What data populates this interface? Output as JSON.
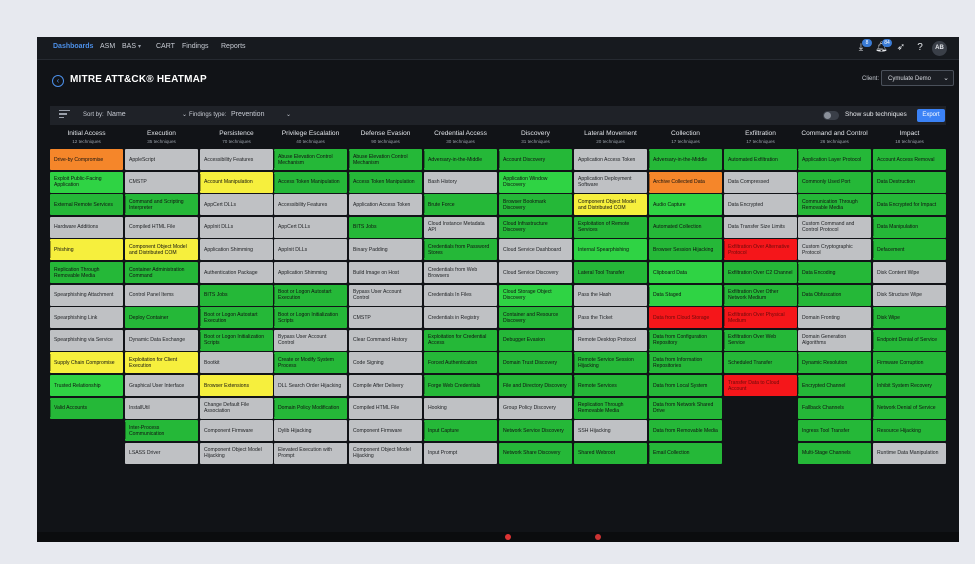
{
  "nav": {
    "items": [
      "Dashboards",
      "ASM",
      "BAS",
      "CART",
      "Findings",
      "Reports"
    ],
    "notif_badge_1": "8",
    "notif_badge_2": "84",
    "avatar": "AB"
  },
  "page": {
    "title": "MITRE ATT&CK® HEATMAP",
    "client_label": "Client:",
    "client_value": "Cymulate Demo"
  },
  "controls": {
    "sort_label": "Sort by:",
    "sort_value": "Name",
    "findings_label": "Findings type:",
    "findings_value": "Prevention",
    "toggle_label": "Show sub techniques",
    "export_label": "Export"
  },
  "colors": {
    "gray": "#bfc1c4",
    "green_bright": "#2fd344",
    "green": "#25b838",
    "green_dark": "#1aa32c",
    "lime": "#c8ef2c",
    "yellow": "#f6ef3d",
    "orange": "#f5862a",
    "red": "#f5161a",
    "accent": "#3b82f6"
  },
  "columns": [
    {
      "name": "Initial Access",
      "count": "12 techniques",
      "cells": [
        {
          "label": "Drive-by Compromise",
          "c": "orange"
        },
        {
          "label": "Exploit Public-Facing Application",
          "c": "g1"
        },
        {
          "label": "External Remote Services",
          "c": "g2"
        },
        {
          "label": "Hardware Additions",
          "c": "gray"
        },
        {
          "label": "Phishing",
          "c": "yellow",
          "s": 1
        },
        {
          "label": "Replication Through Removable Media",
          "c": "g2"
        },
        {
          "label": "Spearphishing Attachment",
          "c": "gray"
        },
        {
          "label": "Spearphishing Link",
          "c": "gray"
        },
        {
          "label": "Spearphishing via Service",
          "c": "gray"
        },
        {
          "label": "Supply Chain Compromise",
          "c": "yellow",
          "s": 1
        },
        {
          "label": "Trusted Relationship",
          "c": "g1"
        },
        {
          "label": "Valid Accounts",
          "c": "g2",
          "s": 1
        }
      ]
    },
    {
      "name": "Execution",
      "count": "35 techniques",
      "cells": [
        {
          "label": "AppleScript",
          "c": "gray"
        },
        {
          "label": "CMSTP",
          "c": "gray"
        },
        {
          "label": "Command and Scripting Interpreter",
          "c": "g2",
          "s": 1
        },
        {
          "label": "Compiled HTML File",
          "c": "gray"
        },
        {
          "label": "Component Object Model and Distributed COM",
          "c": "yellow"
        },
        {
          "label": "Container Administration Command",
          "c": "g2"
        },
        {
          "label": "Control Panel Items",
          "c": "gray"
        },
        {
          "label": "Deploy Container",
          "c": "g2"
        },
        {
          "label": "Dynamic Data Exchange",
          "c": "gray"
        },
        {
          "label": "Exploitation for Client Execution",
          "c": "yellow"
        },
        {
          "label": "Graphical User Interface",
          "c": "gray"
        },
        {
          "label": "InstallUtil",
          "c": "gray"
        },
        {
          "label": "Inter-Process Communication",
          "c": "g2",
          "s": 1
        },
        {
          "label": "LSASS Driver",
          "c": "gray"
        }
      ]
    },
    {
      "name": "Persistence",
      "count": "70 techniques",
      "cells": [
        {
          "label": "Accessibility Features",
          "c": "gray"
        },
        {
          "label": "Account Manipulation",
          "c": "yellow",
          "s": 1
        },
        {
          "label": "AppCert DLLs",
          "c": "gray"
        },
        {
          "label": "AppInit DLLs",
          "c": "gray"
        },
        {
          "label": "Application Shimming",
          "c": "gray"
        },
        {
          "label": "Authentication Package",
          "c": "gray"
        },
        {
          "label": "BITS Jobs",
          "c": "g2"
        },
        {
          "label": "Boot or Logon Autostart Execution",
          "c": "g2",
          "s": 1
        },
        {
          "label": "Boot or Logon Initialization Scripts",
          "c": "g2",
          "s": 1
        },
        {
          "label": "Bootkit",
          "c": "gray"
        },
        {
          "label": "Browser Extensions",
          "c": "yellow"
        },
        {
          "label": "Change Default File Association",
          "c": "gray"
        },
        {
          "label": "Component Firmware",
          "c": "gray"
        },
        {
          "label": "Component Object Model Hijacking",
          "c": "gray"
        }
      ]
    },
    {
      "name": "Privilege Escalation",
      "count": "40 techniques",
      "cells": [
        {
          "label": "Abuse Elevation Control Mechanism",
          "c": "g2",
          "s": 1
        },
        {
          "label": "Access Token Manipulation",
          "c": "g2",
          "s": 1
        },
        {
          "label": "Accessibility Features",
          "c": "gray"
        },
        {
          "label": "AppCert DLLs",
          "c": "gray"
        },
        {
          "label": "AppInit DLLs",
          "c": "gray"
        },
        {
          "label": "Application Shimming",
          "c": "gray"
        },
        {
          "label": "Boot or Logon Autostart Execution",
          "c": "g2",
          "s": 1
        },
        {
          "label": "Boot or Logon Initialization Scripts",
          "c": "g2",
          "s": 1
        },
        {
          "label": "Bypass User Account Control",
          "c": "gray"
        },
        {
          "label": "Create or Modify System Process",
          "c": "g2",
          "s": 1
        },
        {
          "label": "DLL Search Order Hijacking",
          "c": "gray"
        },
        {
          "label": "Domain Policy Modification",
          "c": "g2",
          "s": 1
        },
        {
          "label": "Dylib Hijacking",
          "c": "gray"
        },
        {
          "label": "Elevated Execution with Prompt",
          "c": "gray"
        }
      ]
    },
    {
      "name": "Defense Evasion",
      "count": "90 techniques",
      "cells": [
        {
          "label": "Abuse Elevation Control Mechanism",
          "c": "g2",
          "s": 1
        },
        {
          "label": "Access Token Manipulation",
          "c": "g2",
          "s": 1
        },
        {
          "label": "Application Access Token",
          "c": "gray"
        },
        {
          "label": "BITS Jobs",
          "c": "g2"
        },
        {
          "label": "Binary Padding",
          "c": "gray"
        },
        {
          "label": "Build Image on Host",
          "c": "gray"
        },
        {
          "label": "Bypass User Account Control",
          "c": "gray"
        },
        {
          "label": "CMSTP",
          "c": "gray"
        },
        {
          "label": "Clear Command History",
          "c": "gray"
        },
        {
          "label": "Code Signing",
          "c": "gray"
        },
        {
          "label": "Compile After Delivery",
          "c": "gray"
        },
        {
          "label": "Compiled HTML File",
          "c": "gray"
        },
        {
          "label": "Component Firmware",
          "c": "gray"
        },
        {
          "label": "Component Object Model Hijacking",
          "c": "gray"
        }
      ]
    },
    {
      "name": "Credential Access",
      "count": "30 techniques",
      "cells": [
        {
          "label": "Adversary-in-the-Middle",
          "c": "g2",
          "s": 1
        },
        {
          "label": "Bash History",
          "c": "gray"
        },
        {
          "label": "Brute Force",
          "c": "g2",
          "s": 1
        },
        {
          "label": "Cloud Instance Metadata API",
          "c": "gray"
        },
        {
          "label": "Credentials from Password Stores",
          "c": "g2",
          "s": 1
        },
        {
          "label": "Credentials from Web Browsers",
          "c": "gray"
        },
        {
          "label": "Credentials In Files",
          "c": "gray"
        },
        {
          "label": "Credentials in Registry",
          "c": "gray"
        },
        {
          "label": "Exploitation for Credential Access",
          "c": "g2"
        },
        {
          "label": "Forced Authentication",
          "c": "g2"
        },
        {
          "label": "Forge Web Credentials",
          "c": "g2",
          "s": 1
        },
        {
          "label": "Hooking",
          "c": "gray"
        },
        {
          "label": "Input Capture",
          "c": "g2",
          "s": 1
        },
        {
          "label": "Input Prompt",
          "c": "gray"
        }
      ]
    },
    {
      "name": "Discovery",
      "count": "31 techniques",
      "cells": [
        {
          "label": "Account Discovery",
          "c": "g2",
          "s": 1
        },
        {
          "label": "Application Window Discovery",
          "c": "g1"
        },
        {
          "label": "Browser Bookmark Discovery",
          "c": "g2"
        },
        {
          "label": "Cloud Infrastructure Discovery",
          "c": "g2"
        },
        {
          "label": "Cloud Service Dashboard",
          "c": "gray"
        },
        {
          "label": "Cloud Service Discovery",
          "c": "gray"
        },
        {
          "label": "Cloud Storage Object Discovery",
          "c": "g1"
        },
        {
          "label": "Container and Resource Discovery",
          "c": "g2"
        },
        {
          "label": "Debugger Evasion",
          "c": "g2"
        },
        {
          "label": "Domain Trust Discovery",
          "c": "g2"
        },
        {
          "label": "File and Directory Discovery",
          "c": "g2"
        },
        {
          "label": "Group Policy Discovery",
          "c": "gray"
        },
        {
          "label": "Network Service Discovery",
          "c": "g2"
        },
        {
          "label": "Network Share Discovery",
          "c": "g2"
        }
      ]
    },
    {
      "name": "Lateral Movement",
      "count": "20 techniques",
      "cells": [
        {
          "label": "Application Access Token",
          "c": "gray"
        },
        {
          "label": "Application Deployment Software",
          "c": "gray"
        },
        {
          "label": "Component Object Model and Distributed COM",
          "c": "yellow"
        },
        {
          "label": "Exploitation of Remote Services",
          "c": "g2"
        },
        {
          "label": "Internal Spearphishing",
          "c": "g1"
        },
        {
          "label": "Lateral Tool Transfer",
          "c": "g2"
        },
        {
          "label": "Pass the Hash",
          "c": "gray"
        },
        {
          "label": "Pass the Ticket",
          "c": "gray"
        },
        {
          "label": "Remote Desktop Protocol",
          "c": "gray"
        },
        {
          "label": "Remote Service Session Hijacking",
          "c": "g2",
          "s": 1
        },
        {
          "label": "Remote Services",
          "c": "g2",
          "s": 1
        },
        {
          "label": "Replication Through Removable Media",
          "c": "g2"
        },
        {
          "label": "SSH Hijacking",
          "c": "gray"
        },
        {
          "label": "Shared Webroot",
          "c": "g2"
        }
      ]
    },
    {
      "name": "Collection",
      "count": "17 techniques",
      "cells": [
        {
          "label": "Adversary-in-the-Middle",
          "c": "g2",
          "s": 1
        },
        {
          "label": "Archive Collected Data",
          "c": "orange",
          "s": 1
        },
        {
          "label": "Audio Capture",
          "c": "g1"
        },
        {
          "label": "Automated Collection",
          "c": "g2"
        },
        {
          "label": "Browser Session Hijacking",
          "c": "g2"
        },
        {
          "label": "Clipboard Data",
          "c": "g1"
        },
        {
          "label": "Data Staged",
          "c": "g1",
          "s": 1
        },
        {
          "label": "Data from Cloud Storage",
          "c": "red"
        },
        {
          "label": "Data from Configuration Repository",
          "c": "g2",
          "s": 1
        },
        {
          "label": "Data from Information Repositories",
          "c": "g2",
          "s": 1
        },
        {
          "label": "Data from Local System",
          "c": "g2"
        },
        {
          "label": "Data from Network Shared Drive",
          "c": "g2"
        },
        {
          "label": "Data from Removable Media",
          "c": "g2"
        },
        {
          "label": "Email Collection",
          "c": "g2",
          "s": 1
        }
      ]
    },
    {
      "name": "Exfiltration",
      "count": "17 techniques",
      "cells": [
        {
          "label": "Automated Exfiltration",
          "c": "g2"
        },
        {
          "label": "Data Compressed",
          "c": "gray"
        },
        {
          "label": "Data Encrypted",
          "c": "gray"
        },
        {
          "label": "Data Transfer Size Limits",
          "c": "gray"
        },
        {
          "label": "Exfiltration Over Alternative Protocol",
          "c": "red",
          "s": 1
        },
        {
          "label": "Exfiltration Over C2 Channel",
          "c": "g2"
        },
        {
          "label": "Exfiltration Over Other Network Medium",
          "c": "g2",
          "s": 1
        },
        {
          "label": "Exfiltration Over Physical Medium",
          "c": "red",
          "s": 1
        },
        {
          "label": "Exfiltration Over Web Service",
          "c": "g2",
          "s": 1
        },
        {
          "label": "Scheduled Transfer",
          "c": "g2"
        },
        {
          "label": "Transfer Data to Cloud Account",
          "c": "red"
        }
      ]
    },
    {
      "name": "Command and Control",
      "count": "26 techniques",
      "cells": [
        {
          "label": "Application Layer Protocol",
          "c": "g2",
          "s": 1
        },
        {
          "label": "Commonly Used Port",
          "c": "g2"
        },
        {
          "label": "Communication Through Removable Media",
          "c": "g2"
        },
        {
          "label": "Custom Command and Control Protocol",
          "c": "gray"
        },
        {
          "label": "Custom Cryptographic Protocol",
          "c": "gray"
        },
        {
          "label": "Data Encoding",
          "c": "g2",
          "s": 1
        },
        {
          "label": "Data Obfuscation",
          "c": "g2",
          "s": 1
        },
        {
          "label": "Domain Fronting",
          "c": "gray"
        },
        {
          "label": "Domain Generation Algorithms",
          "c": "gray"
        },
        {
          "label": "Dynamic Resolution",
          "c": "g2",
          "s": 1
        },
        {
          "label": "Encrypted Channel",
          "c": "g2",
          "s": 1
        },
        {
          "label": "Fallback Channels",
          "c": "g2"
        },
        {
          "label": "Ingress Tool Transfer",
          "c": "g2"
        },
        {
          "label": "Multi-Stage Channels",
          "c": "g2"
        }
      ]
    },
    {
      "name": "Impact",
      "count": "18 techniques",
      "cells": [
        {
          "label": "Account Access Removal",
          "c": "g2"
        },
        {
          "label": "Data Destruction",
          "c": "g2"
        },
        {
          "label": "Data Encrypted for Impact",
          "c": "g2"
        },
        {
          "label": "Data Manipulation",
          "c": "g2",
          "s": 1
        },
        {
          "label": "Defacement",
          "c": "g2",
          "s": 1
        },
        {
          "label": "Disk Content Wipe",
          "c": "gray"
        },
        {
          "label": "Disk Structure Wipe",
          "c": "gray"
        },
        {
          "label": "Disk Wipe",
          "c": "g2",
          "s": 1
        },
        {
          "label": "Endpoint Denial of Service",
          "c": "g2",
          "s": 1
        },
        {
          "label": "Firmware Corruption",
          "c": "g2"
        },
        {
          "label": "Inhibit System Recovery",
          "c": "g2"
        },
        {
          "label": "Network Denial of Service",
          "c": "g2",
          "s": 1
        },
        {
          "label": "Resource Hijacking",
          "c": "g2"
        },
        {
          "label": "Runtime Data Manipulation",
          "c": "gray"
        }
      ]
    }
  ]
}
